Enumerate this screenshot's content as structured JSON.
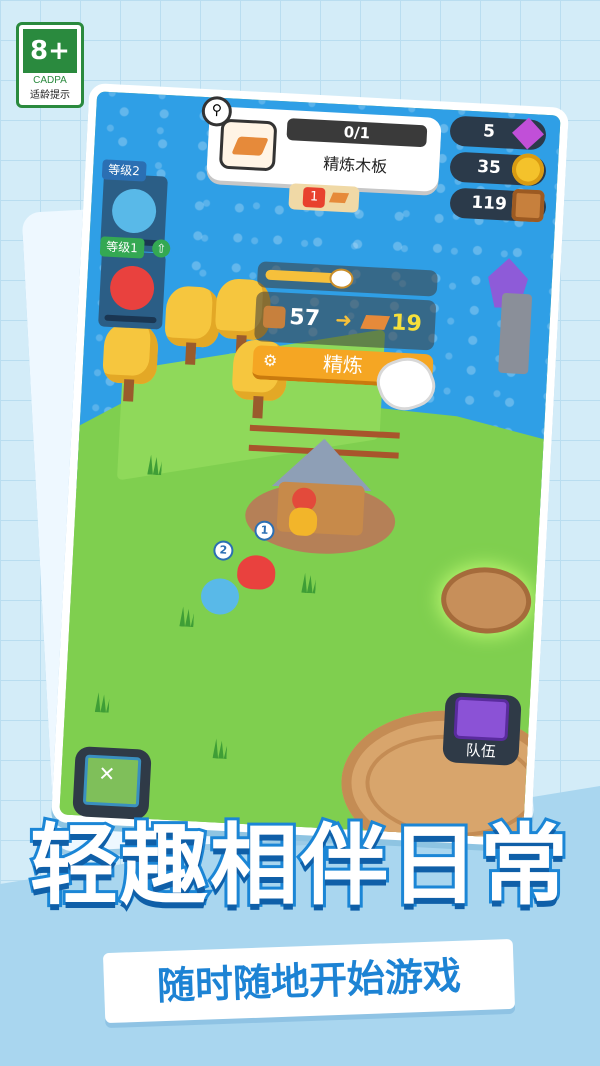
{
  "age_rating": {
    "rating": "8+",
    "org": "CADPA",
    "hint": "适龄提示"
  },
  "quest": {
    "progress": "0/1",
    "title": "精炼木板",
    "count": "1"
  },
  "resources": {
    "gems": "5",
    "coins": "35",
    "wood": "119"
  },
  "pets": [
    {
      "level": "等级2"
    },
    {
      "level": "等级1"
    }
  ],
  "craft": {
    "input": "57",
    "output": "19",
    "button_label": "精炼"
  },
  "team_button": {
    "label": "队伍"
  },
  "followers": [
    {
      "badge": "1"
    },
    {
      "badge": "2"
    }
  ],
  "slogan": "轻趣相伴日常",
  "sub_slogan": "随时随地开始游戏",
  "colors": {
    "slogan_stroke": "#1b86d6",
    "sub_slogan": "#1d83d4",
    "craft_button": "#f5a623"
  }
}
